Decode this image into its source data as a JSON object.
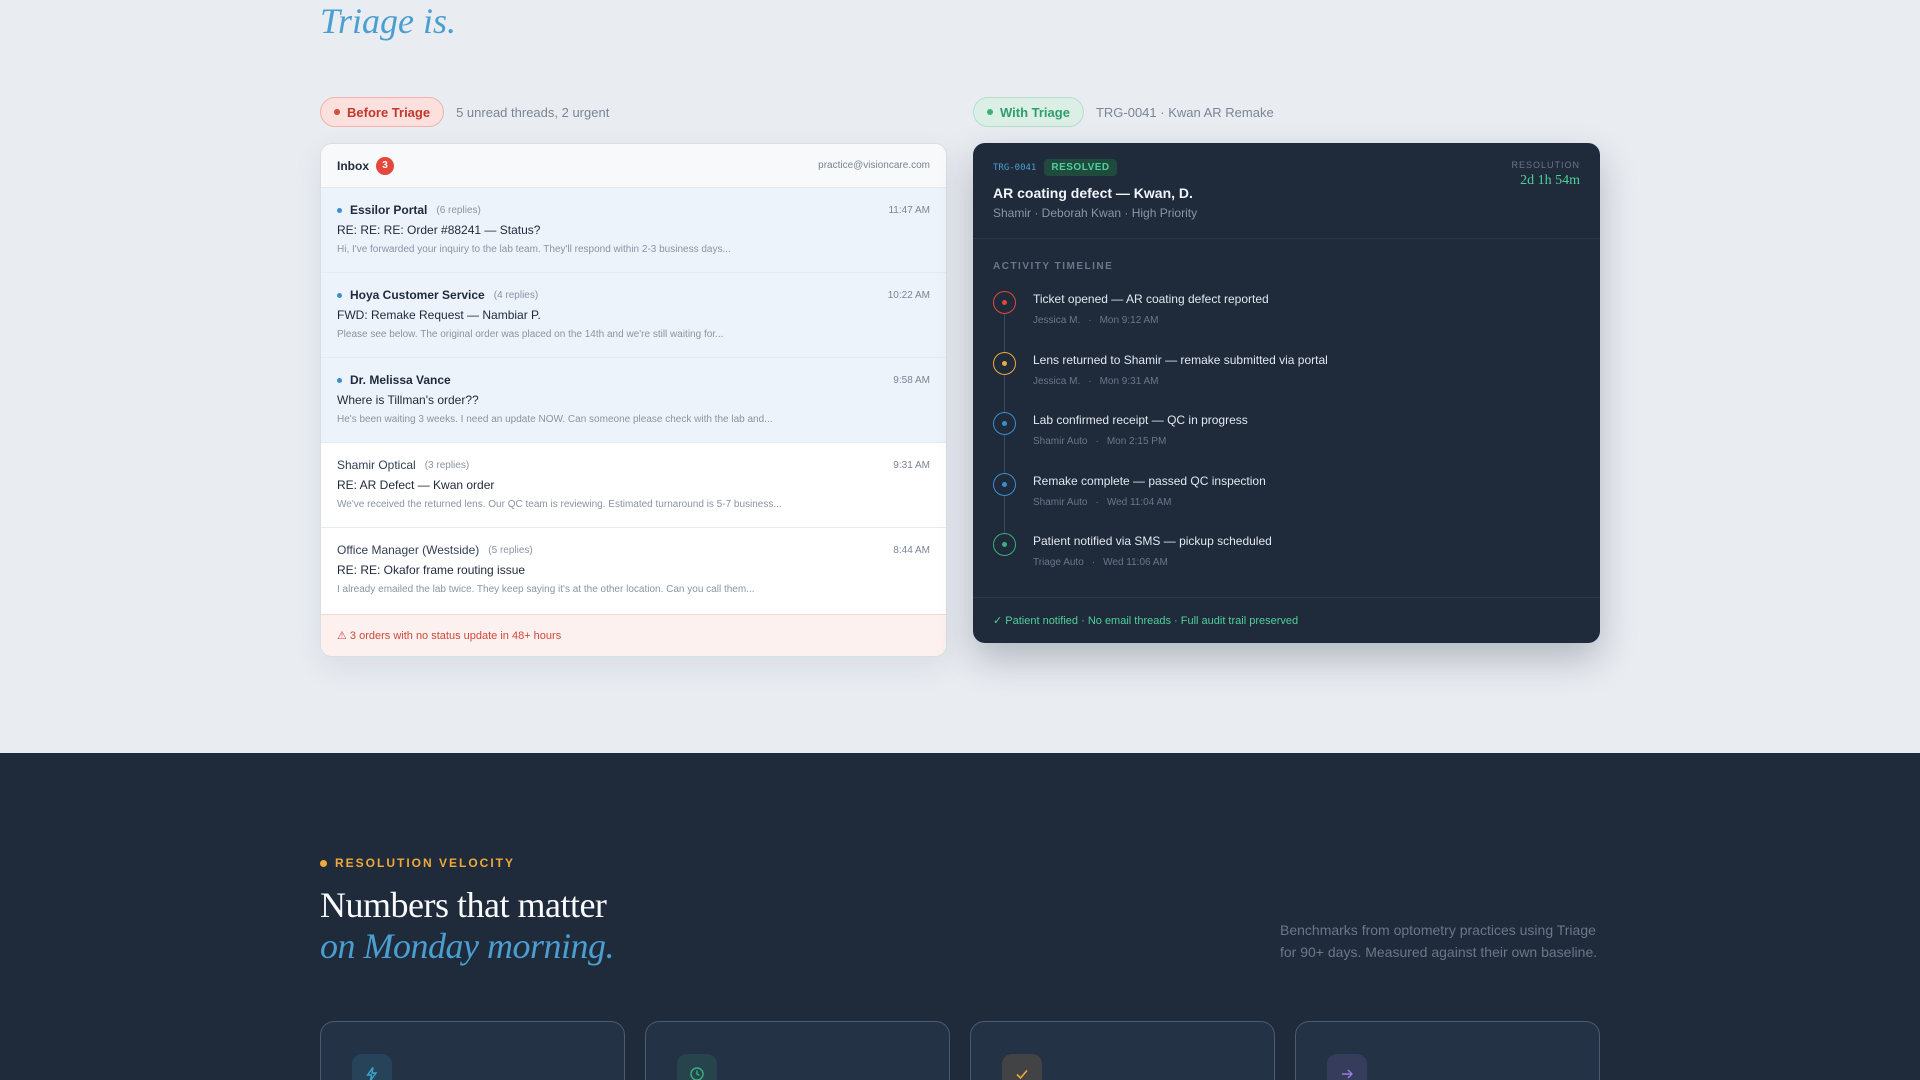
{
  "hero": {
    "tail": "Triage is."
  },
  "before": {
    "pill": "Before Triage",
    "note": "5 unread threads, 2 urgent"
  },
  "with": {
    "pill": "With Triage",
    "note": "TRG-0041 · Kwan AR Remake"
  },
  "inbox": {
    "title": "Inbox",
    "count": "3",
    "email": "practice@visioncare.com",
    "messages": [
      {
        "from": "Essilor Portal",
        "replies": "(6 replies)",
        "time": "11:47 AM",
        "subject": "RE: RE: RE: Order #88241 — Status?",
        "preview": "Hi, I've forwarded your inquiry to the lab team. They'll respond within 2-3 business days...",
        "unread": true
      },
      {
        "from": "Hoya Customer Service",
        "replies": "(4 replies)",
        "time": "10:22 AM",
        "subject": "FWD: Remake Request — Nambiar P.",
        "preview": "Please see below. The original order was placed on the 14th and we're still waiting for...",
        "unread": true
      },
      {
        "from": "Dr. Melissa Vance",
        "replies": "",
        "time": "9:58 AM",
        "subject": "Where is Tillman's order??",
        "preview": "He's been waiting 3 weeks. I need an update NOW. Can someone please check with the lab and...",
        "unread": true
      },
      {
        "from": "Shamir Optical",
        "replies": "(3 replies)",
        "time": "9:31 AM",
        "subject": "RE: AR Defect — Kwan order",
        "preview": "We've received the returned lens. Our QC team is reviewing. Estimated turnaround is 5-7 business...",
        "unread": false
      },
      {
        "from": "Office Manager (Westside)",
        "replies": "(5 replies)",
        "time": "8:44 AM",
        "subject": "RE: RE: Okafor frame routing issue",
        "preview": "I already emailed the lab twice. They keep saying it's at the other location. Can you call them...",
        "unread": false
      }
    ],
    "alert": "⚠ 3 orders with no status update in 48+ hours"
  },
  "ticket": {
    "id": "TRG-0041",
    "status": "RESOLVED",
    "title": "AR coating defect — Kwan, D.",
    "meta": "Shamir · Deborah Kwan · High Priority",
    "resolution_label": "RESOLUTION",
    "resolution_value": "2d 1h 54m",
    "timeline_label": "ACTIVITY TIMELINE",
    "events": [
      {
        "text": "Ticket opened — AR coating defect reported",
        "who": "Jessica M.",
        "when": "Mon 9:12 AM",
        "color": "#e2483c"
      },
      {
        "text": "Lens returned to Shamir — remake submitted via portal",
        "who": "Jessica M.",
        "when": "Mon 9:31 AM",
        "color": "#f2a93b"
      },
      {
        "text": "Lab confirmed receipt — QC in progress",
        "who": "Shamir Auto",
        "when": "Mon 2:15 PM",
        "color": "#3b8fd0"
      },
      {
        "text": "Remake complete — passed QC inspection",
        "who": "Shamir Auto",
        "when": "Wed 11:04 AM",
        "color": "#3b8fd0"
      },
      {
        "text": "Patient notified via SMS — pickup scheduled",
        "who": "Triage Auto",
        "when": "Wed 11:06 AM",
        "color": "#3bb07a"
      }
    ],
    "footer": "✓ Patient notified · No email threads · Full audit trail preserved"
  },
  "velocity": {
    "eyebrow": "RESOLUTION VELOCITY",
    "heading": "Numbers that matter",
    "heading_italic": "on Monday morning.",
    "benchmark": "Benchmarks from optometry practices using Triage for 90+ days. Measured against their own baseline.",
    "cards": [
      {
        "icon": "lightning-icon",
        "color": "#3ba7c9"
      },
      {
        "icon": "clock-icon",
        "color": "#3bb07a"
      },
      {
        "icon": "check-icon",
        "color": "#f2a93b"
      },
      {
        "icon": "arrow-right-icon",
        "color": "#9a7be0"
      }
    ]
  }
}
